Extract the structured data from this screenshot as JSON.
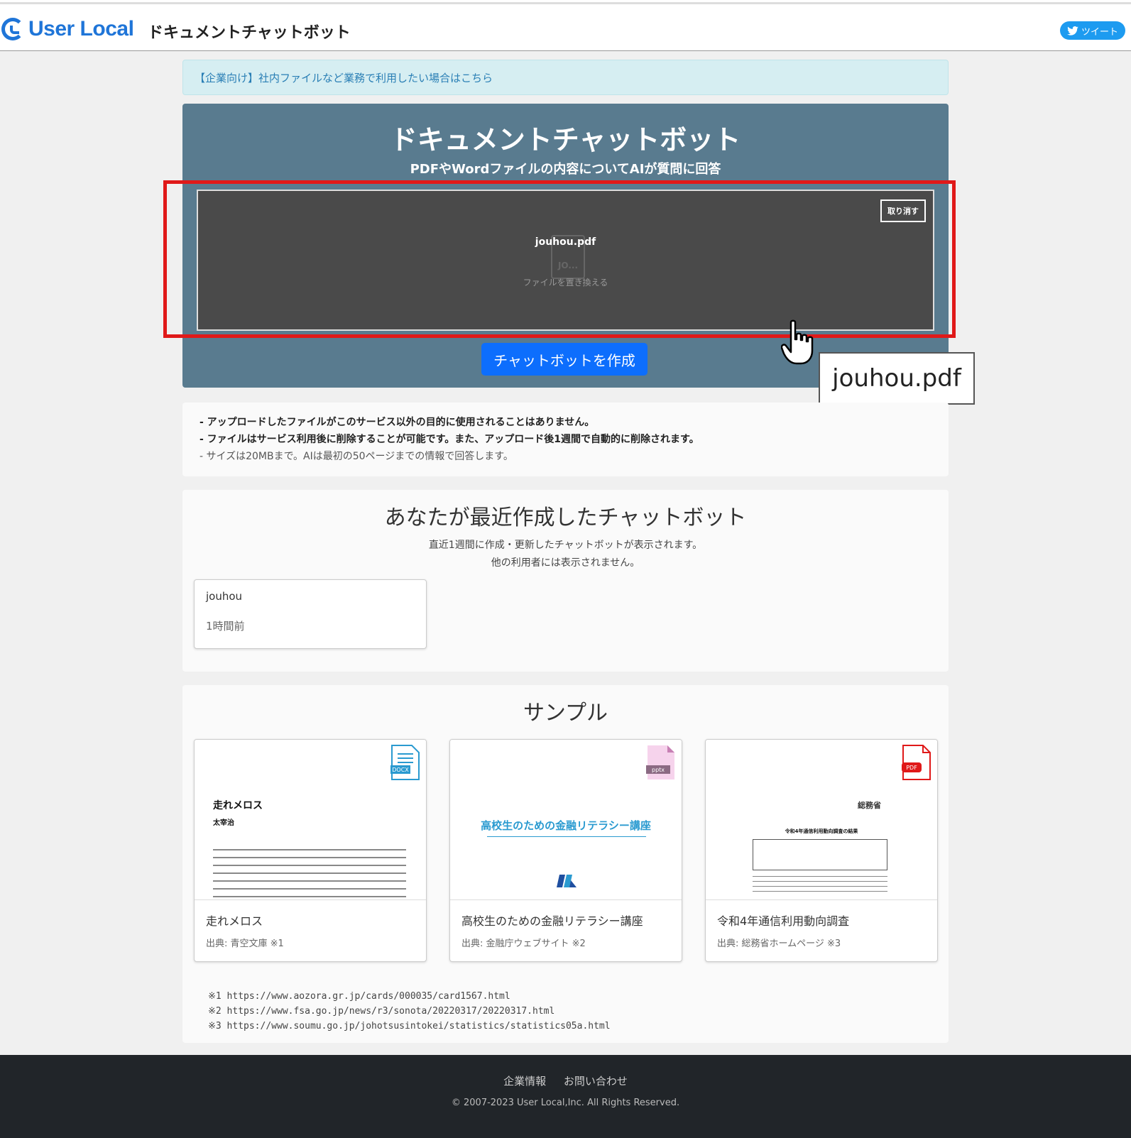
{
  "header": {
    "logo_text": "User Local",
    "app_name": "ドキュメントチャットボット",
    "tweet_label": "ツイート"
  },
  "notice": {
    "text": "【企業向け】社内ファイルなど業務で利用したい場合はこちら"
  },
  "hero": {
    "title": "ドキュメントチャットボット",
    "subtitle": "PDFやWordファイルの内容についてAIが質問に回答",
    "cancel_label": "取り消す",
    "file_name": "jouhou.pdf",
    "file_icon_label": "JO...",
    "replace_label": "ファイルを置き換える",
    "create_button": "チャットボットを作成"
  },
  "tooltip": {
    "text": "jouhou.pdf"
  },
  "info": {
    "line1": "- アップロードしたファイルがこのサービス以外の目的に使用されることはありません。",
    "line2": "- ファイルはサービス利用後に削除することが可能です。また、アップロード後1週間で自動的に削除されます。",
    "line3": "- サイズは20MBまで。AIは最初の50ページまでの情報で回答します。"
  },
  "recent": {
    "title": "あなたが最近作成したチャットボット",
    "desc1": "直近1週間に作成・更新したチャットボットが表示されます。",
    "desc2": "他の利用者には表示されません。",
    "bots": [
      {
        "name": "jouhou",
        "time": "1時間前"
      }
    ]
  },
  "samples": {
    "title": "サンプル",
    "items": [
      {
        "title": "走れメロス",
        "source": "出典: 青空文庫 ※1",
        "badge": "DOCX",
        "thumb_title": "走れメロス",
        "thumb_author": "太宰治"
      },
      {
        "title": "高校生のための金融リテラシー講座",
        "source": "出典: 金融庁ウェブサイト ※2",
        "badge": "pptx",
        "thumb_title": "高校生のための金融リテラシー講座"
      },
      {
        "title": "令和4年通信利用動向調査",
        "source": "出典: 総務省ホームページ ※3",
        "badge": "PDF",
        "thumb_org": "総務省",
        "thumb_heading": "令和4年通信利用動向調査の結果"
      }
    ],
    "footnotes": [
      "※1 https://www.aozora.gr.jp/cards/000035/card1567.html",
      "※2 https://www.fsa.go.jp/news/r3/sonota/20220317/20220317.html",
      "※3 https://www.soumu.go.jp/johotsusintokei/statistics/statistics05a.html"
    ]
  },
  "footer": {
    "link_company": "企業情報",
    "link_contact": "お問い合わせ",
    "copyright": "© 2007-2023 User Local,Inc. All Rights Reserved."
  },
  "colors": {
    "brand": "#1f75d8",
    "hero_bg": "#597b8f",
    "primary_button": "#0d6efd",
    "highlight": "#e01919"
  }
}
